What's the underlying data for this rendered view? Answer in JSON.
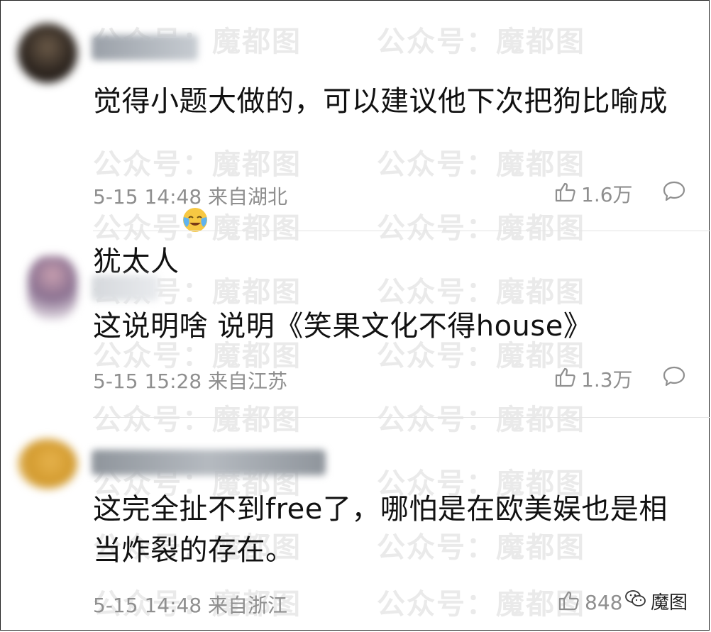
{
  "watermark_text": "公众号：魔都图",
  "brand_label": "魔图",
  "comments": [
    {
      "text": "觉得小题大做的，可以建议他下次把狗比喻成犹太人",
      "time": "5-15 14:48",
      "location": "来自湖北",
      "likes": "1.6万"
    },
    {
      "text": "这说明啥 说明《笑果文化不得house》",
      "time": "5-15 15:28",
      "location": "来自江苏",
      "likes": "1.3万"
    },
    {
      "text": "这完全扯不到free了，哪怕是在欧美娱也是相当炸裂的存在。",
      "time": "5-15 14:48",
      "location": "来自浙江",
      "likes": "848"
    }
  ],
  "icons": {
    "like": "thumbs-up-icon",
    "comment": "comment-bubble-icon",
    "emoji": "crying-laughing-emoji",
    "brand": "wechat-icon"
  },
  "colors": {
    "text": "#111111",
    "meta": "#8f8f8f",
    "watermark": "#bebebe"
  }
}
